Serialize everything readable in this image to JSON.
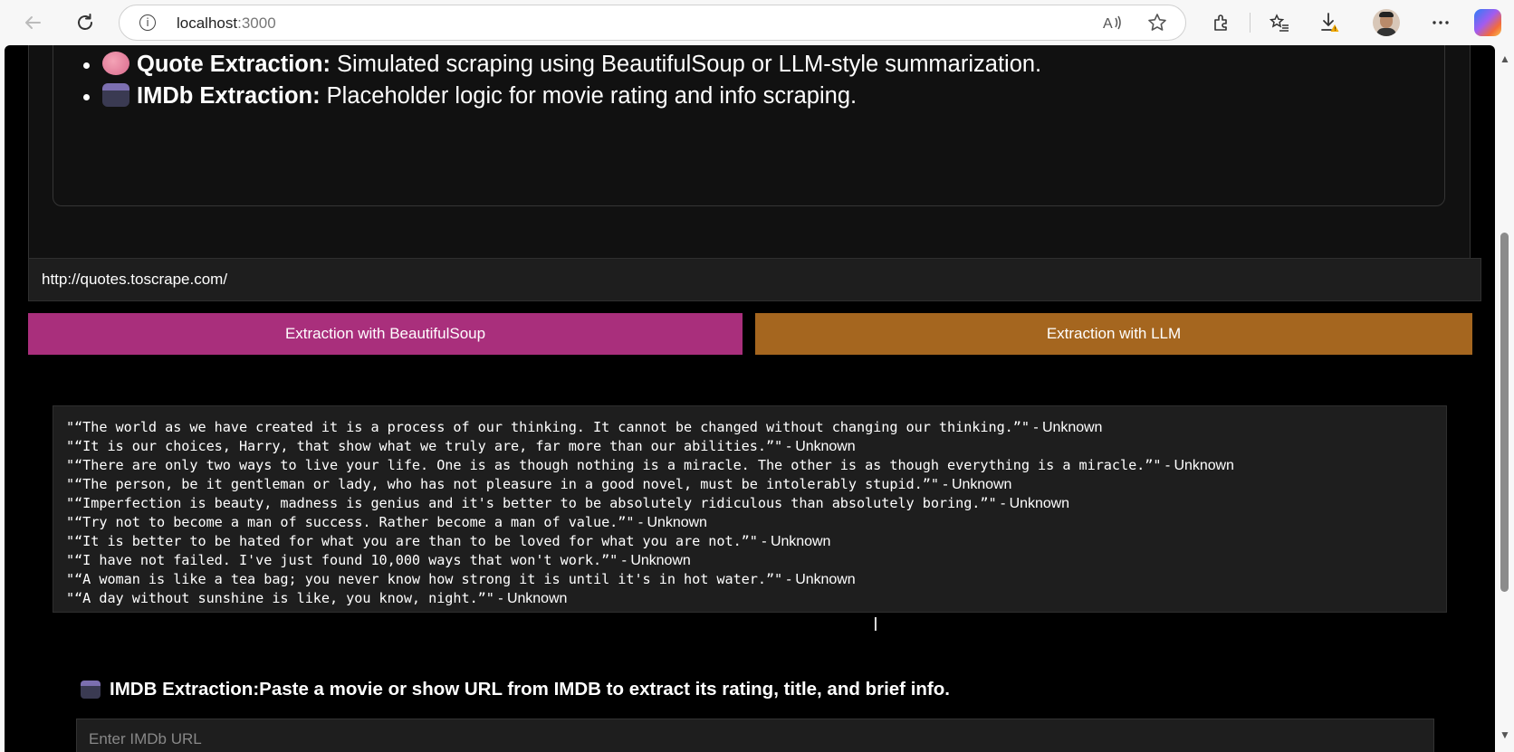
{
  "browser": {
    "url_host": "localhost",
    "url_port": ":3000",
    "icons": {
      "back": "back-arrow-icon",
      "reload": "reload-icon",
      "info": "site-info-icon",
      "read_aloud": "read-aloud-icon",
      "favorite": "favorite-star-icon",
      "extensions": "extensions-icon",
      "favorites": "favorites-list-icon",
      "downloads": "download-icon",
      "menu": "more-menu-icon",
      "copilot": "copilot-icon"
    }
  },
  "features": [
    {
      "title": "Quote Extraction:",
      "desc": " Simulated scraping using BeautifulSoup or LLM-style summarization.",
      "icon": "brain-emoji"
    },
    {
      "title": "IMDb Extraction:",
      "desc": " Placeholder logic for movie rating and info scraping.",
      "icon": "clapper-board-emoji"
    }
  ],
  "url_input": {
    "value": "http://quotes.toscrape.com/"
  },
  "buttons": {
    "beautifulsoup": "Extraction with BeautifulSoup",
    "llm": "Extraction with LLM"
  },
  "colors": {
    "beautifulsoup_button": "#a92f7c",
    "llm_button": "#a5661f",
    "page_background": "#000000",
    "panel_background": "#1e1e1e"
  },
  "results": [
    {
      "quote": "\"“The world as we have created it is a process of our thinking. It cannot be changed without changing our thinking.”\"",
      "author": " - Unknown"
    },
    {
      "quote": "\"“It is our choices, Harry, that show what we truly are, far more than our abilities.”\"",
      "author": " - Unknown"
    },
    {
      "quote": "\"“There are only two ways to live your life. One is as though nothing is a miracle. The other is as though everything is a miracle.”\"",
      "author": " - Unknown"
    },
    {
      "quote": "\"“The person, be it gentleman or lady, who has not pleasure in a good novel, must be intolerably stupid.”\"",
      "author": " - Unknown"
    },
    {
      "quote": "\"“Imperfection is beauty, madness is genius and it's better to be absolutely ridiculous than absolutely boring.”\"",
      "author": " - Unknown"
    },
    {
      "quote": "\"“Try not to become a man of success. Rather become a man of value.”\"",
      "author": " - Unknown"
    },
    {
      "quote": "\"“It is better to be hated for what you are than to be loved for what you are not.”\"",
      "author": " - Unknown"
    },
    {
      "quote": "\"“I have not failed. I've just found 10,000 ways that won't work.”\"",
      "author": " - Unknown"
    },
    {
      "quote": "\"“A woman is like a tea bag; you never know how strong it is until it's in hot water.”\"",
      "author": " - Unknown"
    },
    {
      "quote": "\"“A day without sunshine is like, you know, night.”\"",
      "author": " - Unknown"
    }
  ],
  "imdb": {
    "title": "IMDB Extraction:",
    "desc": " Paste a movie or show URL from IMDB to extract its rating, title, and brief info.",
    "placeholder": "Enter IMDb URL"
  }
}
